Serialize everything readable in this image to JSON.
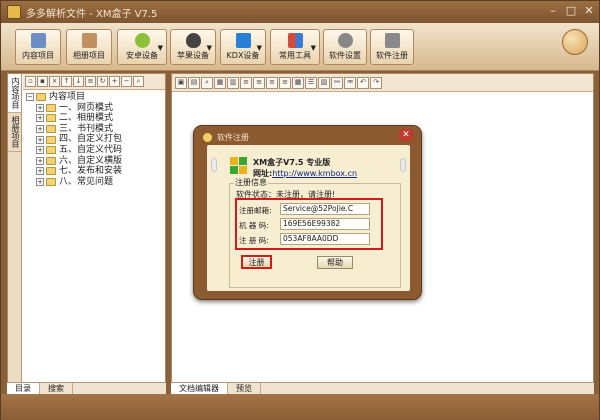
{
  "window": {
    "title": "多多解析文件 - XM盒子 V7.5"
  },
  "toolbar": {
    "buttons": [
      {
        "label": "内容项目",
        "dropdown": false,
        "color": "#6b8fc4"
      },
      {
        "label": "相册项目",
        "dropdown": false,
        "color": "#c09060"
      },
      {
        "label": "安卓设备",
        "dropdown": true,
        "color": "#8cbf3a"
      },
      {
        "label": "苹果设备",
        "dropdown": true,
        "color": "#444444"
      },
      {
        "label": "KDX设备",
        "dropdown": true,
        "color": "#2a7fd6"
      },
      {
        "label": "常用工具",
        "dropdown": true,
        "color": "#d44a3a"
      },
      {
        "label": "软件设置",
        "dropdown": false,
        "color": "#888888"
      },
      {
        "label": "软件注册",
        "dropdown": false,
        "color": "#8a8a8a"
      }
    ]
  },
  "left_panel": {
    "vertical_tabs": [
      "内容项目",
      "相册项目"
    ],
    "tree": [
      {
        "label": "内容项目",
        "level": 0,
        "expander": "−"
      },
      {
        "label": "一、网页模式",
        "level": 1,
        "expander": "+"
      },
      {
        "label": "二、相册模式",
        "level": 1,
        "expander": "+"
      },
      {
        "label": "三、书刊模式",
        "level": 1,
        "expander": "+"
      },
      {
        "label": "四、自定义打包",
        "level": 1,
        "expander": "+"
      },
      {
        "label": "五、自定义代码",
        "level": 1,
        "expander": "+"
      },
      {
        "label": "六、自定义横版",
        "level": 1,
        "expander": "+"
      },
      {
        "label": "七、发布和安装",
        "level": 1,
        "expander": "+"
      },
      {
        "label": "八、常见问题",
        "level": 1,
        "expander": "+"
      }
    ],
    "bottom_tabs": [
      "目录",
      "搜索"
    ]
  },
  "editor": {
    "bottom_tabs": [
      "文档编辑器",
      "预览"
    ]
  },
  "dialog": {
    "title": "软件注册",
    "close": "✕",
    "product_name": "XM盒子V7.5  专业版",
    "website_label": "网址:",
    "website_url": "http://www.kmbox.cn",
    "group_title": "注册信息",
    "status_text": "软件状态：未注册，请注册!",
    "fields": [
      {
        "label": "注册邮箱:",
        "value": "Service@52PoJie.C"
      },
      {
        "label": "机 器 码:",
        "value": "169E56E99382"
      },
      {
        "label": "注 册 码:",
        "value": "053AF8AA0DD"
      }
    ],
    "register_label": "注册",
    "help_label": "帮助"
  }
}
